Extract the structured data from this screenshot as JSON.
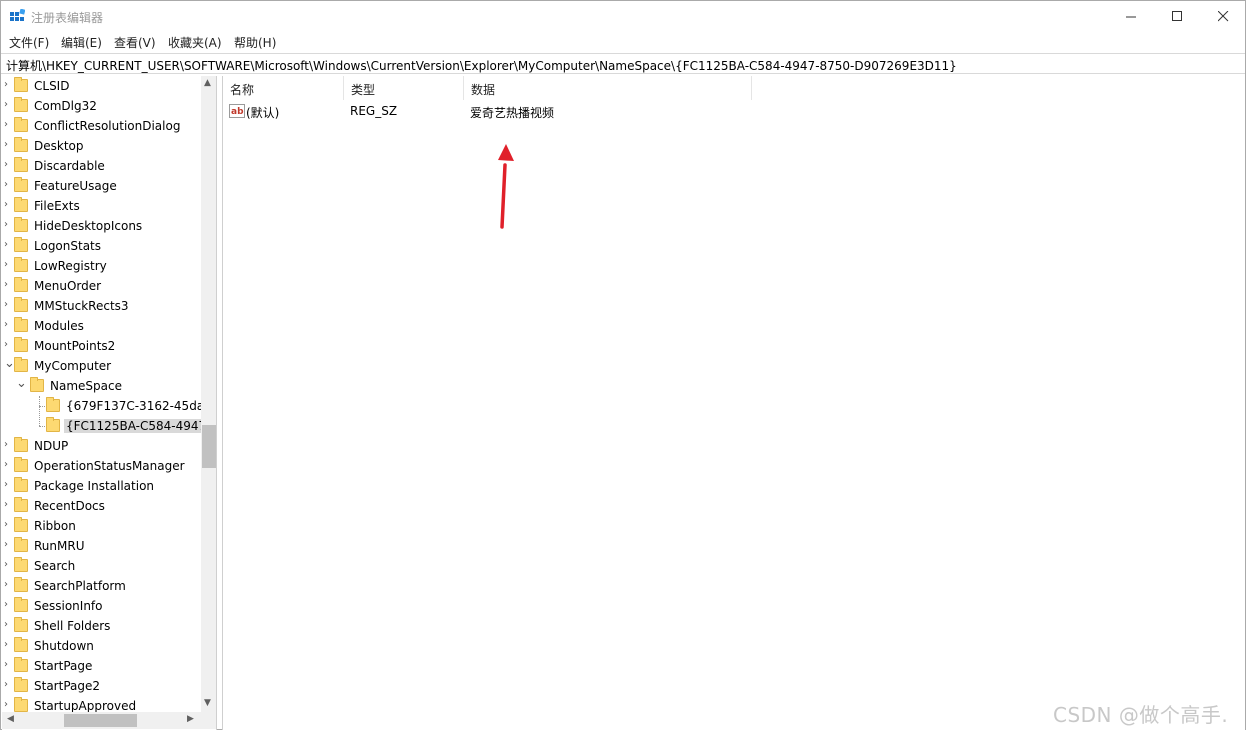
{
  "window": {
    "title": "注册表编辑器",
    "icon": "registry-editor-icon"
  },
  "menubar": {
    "items": [
      "文件(F)",
      "编辑(E)",
      "查看(V)",
      "收藏夹(A)",
      "帮助(H)"
    ]
  },
  "address": {
    "path": "计算机\\HKEY_CURRENT_USER\\SOFTWARE\\Microsoft\\Windows\\CurrentVersion\\Explorer\\MyComputer\\NameSpace\\{FC1125BA-C584-4947-8750-D907269E3D11}"
  },
  "tree": {
    "items": [
      "CLSID",
      "ComDlg32",
      "ConflictResolutionDialog",
      "Desktop",
      "Discardable",
      "FeatureUsage",
      "FileExts",
      "HideDesktopIcons",
      "LogonStats",
      "LowRegistry",
      "MenuOrder",
      "MMStuckRects3",
      "Modules",
      "MountPoints2",
      "MyComputer",
      "NameSpace",
      "{679F137C-3162-45da-",
      "{FC1125BA-C584-4947-",
      "NDUP",
      "OperationStatusManager",
      "Package Installation",
      "RecentDocs",
      "Ribbon",
      "RunMRU",
      "Search",
      "SearchPlatform",
      "SessionInfo",
      "Shell Folders",
      "Shutdown",
      "StartPage",
      "StartPage2",
      "StartupApproved"
    ],
    "selected": "{FC1125BA-C584-4947-"
  },
  "list": {
    "columns": [
      "名称",
      "类型",
      "数据"
    ],
    "rows": [
      {
        "name": "(默认)",
        "type": "REG_SZ",
        "data": "爱奇艺热播视频",
        "icon": "string-value-icon"
      }
    ]
  },
  "annotation": {
    "arrow_color": "#e0202a"
  },
  "watermark": {
    "text": "CSDN @做个高手."
  }
}
